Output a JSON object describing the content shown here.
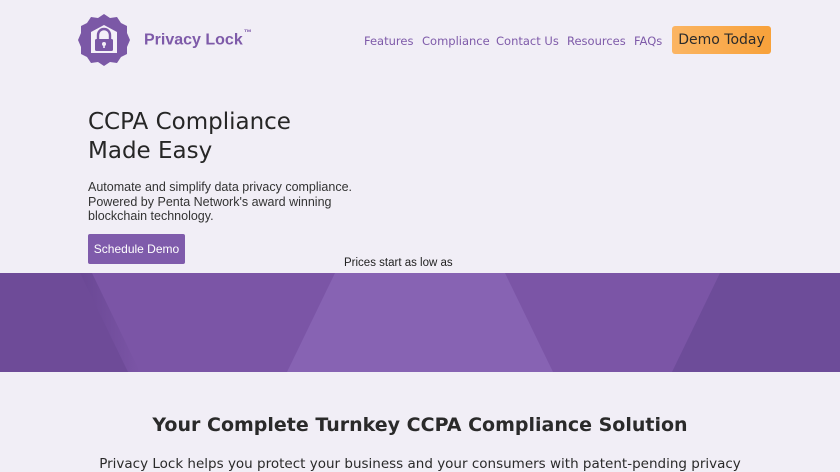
{
  "brand": {
    "name": "Privacy Lock",
    "trademark": "™",
    "logo_icon": "lock-badge-icon",
    "color": "#7e5aa9"
  },
  "nav": {
    "items": [
      {
        "label": "Features"
      },
      {
        "label": "Compliance"
      },
      {
        "label": "Contact Us"
      },
      {
        "label": "Resources"
      },
      {
        "label": "FAQs"
      }
    ],
    "cta_label": "Demo Today",
    "cta_color": "#f8a13a"
  },
  "hero": {
    "title_line1": "CCPA Compliance",
    "title_line2": "Made Easy",
    "desc_line1": "Automate and simplify data privacy compliance.",
    "desc_line2": "Powered by Penta Network's award winning",
    "desc_line3": "blockchain technology.",
    "button_label": "Schedule Demo",
    "button_color": "#7f5bab",
    "prices_caption": "Prices start as low as"
  },
  "solution": {
    "title": "Your Complete Turnkey CCPA Compliance Solution",
    "text": "Privacy Lock helps you protect your business and your consumers with patent-pending privacy"
  }
}
